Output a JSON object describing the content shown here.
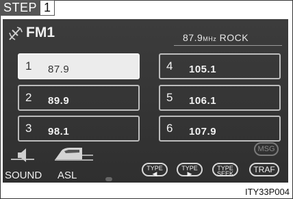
{
  "step": {
    "label": "STEP",
    "number": "1"
  },
  "figure_code": "ITY33P004",
  "header": {
    "band": "FM1",
    "freq": "87.9",
    "unit": "MHz",
    "genre": "ROCK",
    "antenna_icon": "antenna-icon"
  },
  "presets": [
    {
      "num": "1",
      "freq": "87.9",
      "selected": true
    },
    {
      "num": "4",
      "freq": "105.1",
      "selected": false
    },
    {
      "num": "2",
      "freq": "89.9",
      "selected": false
    },
    {
      "num": "5",
      "freq": "106.1",
      "selected": false
    },
    {
      "num": "3",
      "freq": "98.1",
      "selected": false
    },
    {
      "num": "6",
      "freq": "107.9",
      "selected": false
    }
  ],
  "controls": {
    "sound": {
      "label": "SOUND",
      "icon": "speaker-icon"
    },
    "asl": {
      "label": "ASL",
      "icon": "car-icon"
    },
    "msg": "MSG",
    "type_prev": {
      "top": "TYPE",
      "glyph": "◀"
    },
    "type_next": {
      "top": "TYPE",
      "glyph": "▶"
    },
    "type_seek": {
      "top": "TYPE",
      "bottom": "SEEK"
    },
    "traf": "TRAF"
  }
}
